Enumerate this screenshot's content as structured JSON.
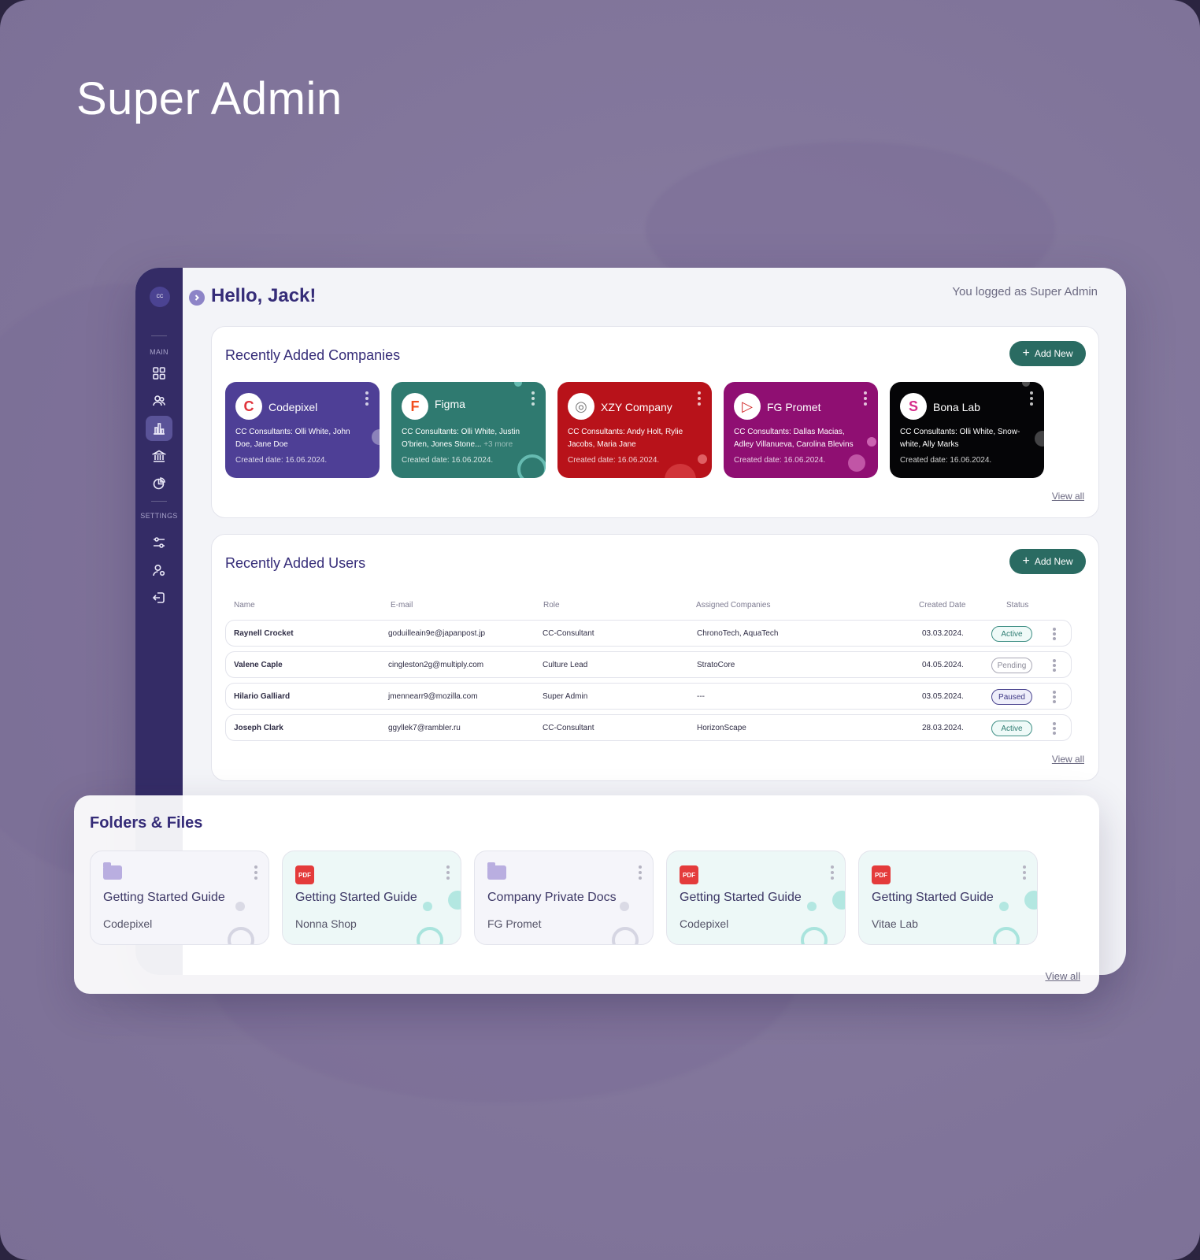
{
  "page": {
    "title": "Super Admin"
  },
  "header": {
    "greeting": "Hello, Jack!",
    "logged_as": "You logged as Super Admin"
  },
  "sidebar": {
    "logo_text": "CC",
    "sections": {
      "main": "MAIN",
      "settings": "SETTINGS"
    },
    "main_icons": [
      "dashboard-icon",
      "users-icon",
      "chart-icon",
      "bank-icon",
      "pie-chart-icon"
    ],
    "settings_icons": [
      "sliders-icon",
      "user-settings-icon",
      "logout-icon"
    ],
    "active": "chart-icon"
  },
  "companies": {
    "title": "Recently Added Companies",
    "add_label": "Add New",
    "view_all": "View all",
    "items": [
      {
        "name": "Codepixel",
        "consultants": "CC Consultants: Olli White, John Doe, Jane Doe",
        "more": "",
        "created": "Created date: 16.06.2024.",
        "color": "#4e3f96",
        "logo": "C",
        "logo_color": "#e0323a"
      },
      {
        "name": "Figma",
        "consultants": "CC Consultants: Olli White, Justin O'brien, Jones Stone...",
        "more": "+3 more",
        "created": "Created date: 16.06.2024.",
        "color": "#2f7a70",
        "logo": "F",
        "logo_color": "#f24e1e"
      },
      {
        "name": "XZY Company",
        "consultants": "CC Consultants: Andy Holt, Rylie Jacobs, Maria Jane",
        "more": "",
        "created": "Created date: 16.06.2024.",
        "color": "#b8121a",
        "logo": "◎",
        "logo_color": "#7a7a7a"
      },
      {
        "name": "FG Promet",
        "consultants": "CC Consultants: Dallas Macias, Adley Villanueva, Carolina Blevins",
        "more": "",
        "created": "Created date: 16.06.2024.",
        "color": "#8f0f72",
        "logo": "▷",
        "logo_color": "#d22b2b"
      },
      {
        "name": "Bona Lab",
        "consultants": "CC Consultants: Olli White, Snow-white, Ally Marks",
        "more": "",
        "created": "Created date: 16.06.2024.",
        "color": "#050507",
        "logo": "S",
        "logo_color": "#d62c8a"
      }
    ]
  },
  "users": {
    "title": "Recently Added Users",
    "add_label": "Add New",
    "view_all": "View all",
    "columns": [
      "Name",
      "E-mail",
      "Role",
      "Assigned Companies",
      "Created Date",
      "Status"
    ],
    "rows": [
      {
        "name": "Raynell Crocket",
        "email": "goduilleain9e@japanpost.jp",
        "role": "CC-Consultant",
        "companies": "ChronoTech, AquaTech",
        "created": "03.03.2024.",
        "status": "Active",
        "status_kind": "active"
      },
      {
        "name": "Valene Caple",
        "email": "cingleston2g@multiply.com",
        "role": "Culture Lead",
        "companies": "StratoCore",
        "created": "04.05.2024.",
        "status": "Pending",
        "status_kind": "pending"
      },
      {
        "name": "Hilario Galliard",
        "email": "jmennearr9@mozilla.com",
        "role": "Super Admin",
        "companies": "---",
        "created": "03.05.2024.",
        "status": "Paused",
        "status_kind": "paused"
      },
      {
        "name": "Joseph Clark",
        "email": "ggyllek7@rambler.ru",
        "role": "CC-Consultant",
        "companies": "HorizonScape",
        "created": "28.03.2024.",
        "status": "Active",
        "status_kind": "active"
      }
    ]
  },
  "files": {
    "title": "Folders & Files",
    "view_all": "View all",
    "items": [
      {
        "kind": "folder",
        "title": "Getting Started Guide",
        "subtitle": "Codepixel"
      },
      {
        "kind": "pdf",
        "title": "Getting Started Guide",
        "subtitle": "Nonna Shop",
        "badge": "PDF"
      },
      {
        "kind": "folder",
        "title": "Company Private Docs",
        "subtitle": "FG Promet"
      },
      {
        "kind": "pdf",
        "title": "Getting Started Guide",
        "subtitle": "Codepixel",
        "badge": "PDF"
      },
      {
        "kind": "pdf",
        "title": "Getting Started Guide",
        "subtitle": "Vitae Lab",
        "badge": "PDF"
      }
    ]
  }
}
